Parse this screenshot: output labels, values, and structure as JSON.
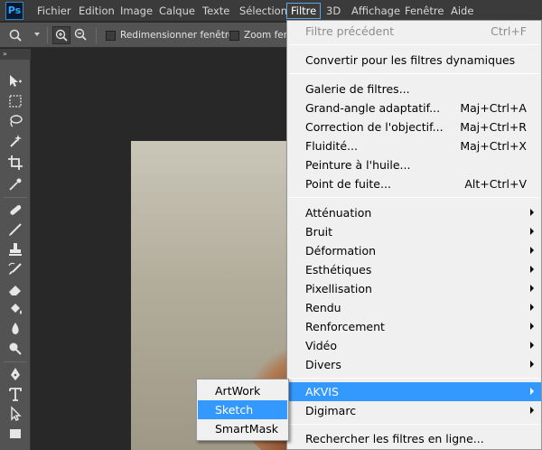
{
  "app": {
    "logo": "Ps"
  },
  "menubar": {
    "items": [
      {
        "label": "Fichier"
      },
      {
        "label": "Edition"
      },
      {
        "label": "Image"
      },
      {
        "label": "Calque"
      },
      {
        "label": "Texte"
      },
      {
        "label": "Sélection"
      },
      {
        "label": "Filtre",
        "active": true
      },
      {
        "label": "3D"
      },
      {
        "label": "Affichage"
      },
      {
        "label": "Fenêtre"
      },
      {
        "label": "Aide"
      }
    ]
  },
  "options": {
    "resize_windows_label": "Redimensionner fenêtres",
    "zoom_all_label": "Zoom fenê"
  },
  "toolbox": {
    "collapse_label": "»"
  },
  "filter_menu": {
    "items": [
      {
        "label": "Filtre précédent",
        "shortcut": "Ctrl+F",
        "disabled": true
      },
      {
        "label": "Convertir pour les filtres dynamiques"
      },
      {
        "label": "Galerie de filtres..."
      },
      {
        "label": "Grand-angle adaptatif...",
        "shortcut": "Maj+Ctrl+A"
      },
      {
        "label": "Correction de l'objectif...",
        "shortcut": "Maj+Ctrl+R"
      },
      {
        "label": "Fluidité...",
        "shortcut": "Maj+Ctrl+X"
      },
      {
        "label": "Peinture à l'huile..."
      },
      {
        "label": "Point de fuite...",
        "shortcut": "Alt+Ctrl+V"
      },
      {
        "label": "Atténuation",
        "submenu": true
      },
      {
        "label": "Bruit",
        "submenu": true
      },
      {
        "label": "Déformation",
        "submenu": true
      },
      {
        "label": "Esthétiques",
        "submenu": true
      },
      {
        "label": "Pixellisation",
        "submenu": true
      },
      {
        "label": "Rendu",
        "submenu": true
      },
      {
        "label": "Renforcement",
        "submenu": true
      },
      {
        "label": "Vidéo",
        "submenu": true
      },
      {
        "label": "Divers",
        "submenu": true
      },
      {
        "label": "AKVIS",
        "submenu": true,
        "highlighted": true
      },
      {
        "label": "Digimarc",
        "submenu": true
      },
      {
        "label": "Rechercher les filtres en ligne..."
      }
    ]
  },
  "akvis_submenu": {
    "items": [
      {
        "label": "ArtWork"
      },
      {
        "label": "Sketch",
        "highlighted": true
      },
      {
        "label": "SmartMask"
      }
    ]
  },
  "colors": {
    "highlight": "#3399ff",
    "menubar_bg": "#3b3b3b",
    "panel_bg": "#535353",
    "canvas_bg": "#282828",
    "menu_bg": "#f0f0f0",
    "active_menu_border": "#5aa7e8"
  }
}
